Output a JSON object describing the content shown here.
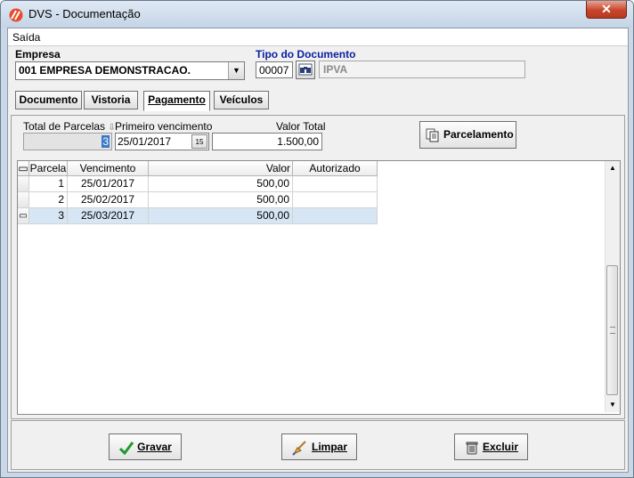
{
  "window": {
    "title": "DVS - Documentação",
    "close_label": "✕"
  },
  "menu": {
    "items": [
      "Saída"
    ]
  },
  "empresa": {
    "label": "Empresa",
    "value": "001 EMPRESA DEMONSTRACAO."
  },
  "tipo_documento": {
    "label": "Tipo do Documento",
    "code": "00007",
    "name": "IPVA"
  },
  "tabs": [
    {
      "label": "Documento"
    },
    {
      "label": "Vistoria"
    },
    {
      "label": "Pagamento"
    },
    {
      "label": "Veículos"
    }
  ],
  "pagamento": {
    "total_parcelas_label": "Total de Parcelas",
    "total_parcelas_value": "3",
    "primeiro_vencimento_label": "Primeiro vencimento",
    "primeiro_vencimento_value": "25/01/2017",
    "valor_total_label": "Valor Total",
    "valor_total_value": "1.500,00",
    "parcelamento_label": "Parcelamento"
  },
  "grid": {
    "columns": [
      "Parcela",
      "Vencimento",
      "Valor",
      "Autorizado"
    ],
    "rows": [
      {
        "parcela": "1",
        "vencimento": "25/01/2017",
        "valor": "500,00",
        "autorizado": ""
      },
      {
        "parcela": "2",
        "vencimento": "25/02/2017",
        "valor": "500,00",
        "autorizado": ""
      },
      {
        "parcela": "3",
        "vencimento": "25/03/2017",
        "valor": "500,00",
        "autorizado": ""
      }
    ]
  },
  "actions": {
    "gravar": "Gravar",
    "limpar": "Limpar",
    "excluir": "Excluir"
  },
  "colors": {
    "title_blue": "#0b1fa0",
    "selected_row": "#d7e6f5",
    "close_red": "#c8462c"
  }
}
